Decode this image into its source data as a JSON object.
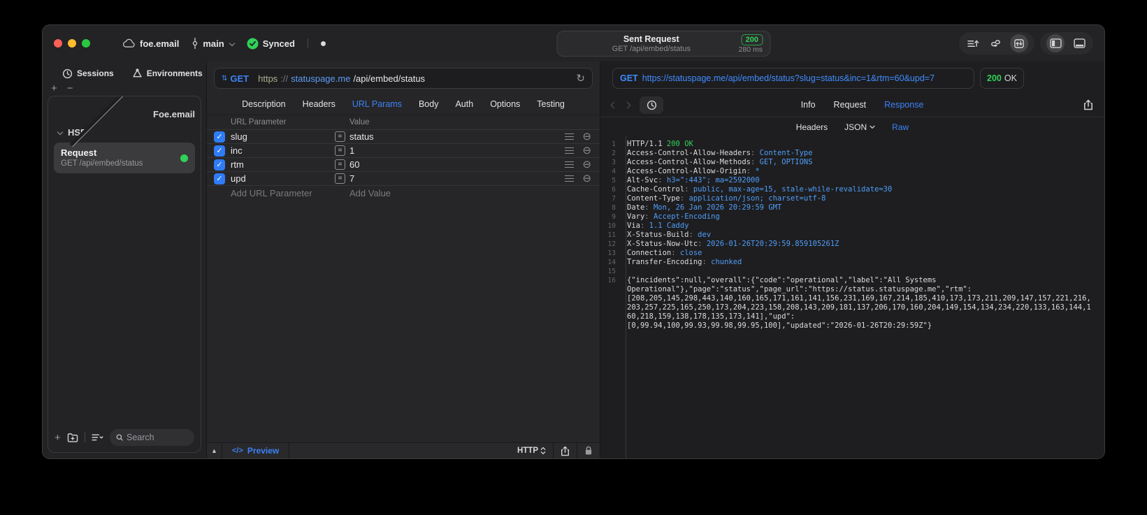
{
  "titlebar": {
    "project": "foe.email",
    "branch": "main",
    "sync_label": "Synced",
    "center": {
      "title": "Sent Request",
      "subtitle": "GET /api/embed/status",
      "status_code": "200",
      "duration": "280 ms"
    }
  },
  "sidebar": {
    "tabs": [
      {
        "label": "Sessions"
      },
      {
        "label": "Environments"
      }
    ],
    "tree": [
      {
        "label": "Foe.email",
        "state": "collapsed"
      },
      {
        "label": "HSP",
        "state": "expanded"
      }
    ],
    "request": {
      "title": "Request",
      "subtitle": "GET /api/embed/status"
    },
    "search_placeholder": "Search"
  },
  "request_panel": {
    "method": "GET",
    "url": {
      "scheme": "https",
      "separator": "://",
      "host": "statuspage.me",
      "path": "/api/embed/status"
    },
    "tabs": [
      "Description",
      "Headers",
      "URL Params",
      "Body",
      "Auth",
      "Options",
      "Testing"
    ],
    "active_tab": "URL Params",
    "params": {
      "col_param": "URL Parameter",
      "col_value": "Value",
      "rows": [
        {
          "name": "slug",
          "value": "status",
          "checked": true
        },
        {
          "name": "inc",
          "value": "1",
          "checked": true
        },
        {
          "name": "rtm",
          "value": "60",
          "checked": true
        },
        {
          "name": "upd",
          "value": "7",
          "checked": true
        }
      ],
      "add_param": "Add URL Parameter",
      "add_value": "Add Value"
    },
    "footer": {
      "preview": "Preview",
      "protocol": "HTTP"
    }
  },
  "response_panel": {
    "method": "GET",
    "url": "https://statuspage.me/api/embed/status?slug=status&inc=1&rtm=60&upd=7",
    "status_code": "200",
    "status_text": "OK",
    "tabs": [
      "Info",
      "Request",
      "Response"
    ],
    "active_tab": "Response",
    "subtabs": [
      "Headers",
      "JSON",
      "Raw"
    ],
    "active_subtab": "Raw",
    "code_lines": [
      {
        "num": "1",
        "seg": [
          [
            "w",
            "HTTP/1.1 "
          ],
          [
            "g",
            "200 OK"
          ]
        ]
      },
      {
        "num": "2",
        "seg": [
          [
            "w",
            "Access-Control-Allow-Headers"
          ],
          [
            "d",
            ": "
          ],
          [
            "b",
            "Content-Type"
          ]
        ]
      },
      {
        "num": "3",
        "seg": [
          [
            "w",
            "Access-Control-Allow-Methods"
          ],
          [
            "d",
            ": "
          ],
          [
            "b",
            "GET, OPTIONS"
          ]
        ]
      },
      {
        "num": "4",
        "seg": [
          [
            "w",
            "Access-Control-Allow-Origin"
          ],
          [
            "d",
            ": "
          ],
          [
            "b",
            "*"
          ]
        ]
      },
      {
        "num": "5",
        "seg": [
          [
            "w",
            "Alt-Svc"
          ],
          [
            "d",
            ": "
          ],
          [
            "b",
            "h3=\":443\"; ma=2592000"
          ]
        ]
      },
      {
        "num": "6",
        "seg": [
          [
            "w",
            "Cache-Control"
          ],
          [
            "d",
            ": "
          ],
          [
            "b",
            "public, max-age=15, stale-while-revalidate=30"
          ]
        ]
      },
      {
        "num": "7",
        "seg": [
          [
            "w",
            "Content-Type"
          ],
          [
            "d",
            ": "
          ],
          [
            "b",
            "application/json; charset=utf-8"
          ]
        ]
      },
      {
        "num": "8",
        "seg": [
          [
            "w",
            "Date"
          ],
          [
            "d",
            ": "
          ],
          [
            "b",
            "Mon, 26 Jan 2026 20:29:59 GMT"
          ]
        ]
      },
      {
        "num": "9",
        "seg": [
          [
            "w",
            "Vary"
          ],
          [
            "d",
            ": "
          ],
          [
            "b",
            "Accept-Encoding"
          ]
        ]
      },
      {
        "num": "10",
        "seg": [
          [
            "w",
            "Via"
          ],
          [
            "d",
            ": "
          ],
          [
            "b",
            "1.1 Caddy"
          ]
        ]
      },
      {
        "num": "11",
        "seg": [
          [
            "w",
            "X-Status-Build"
          ],
          [
            "d",
            ": "
          ],
          [
            "b",
            "dev"
          ]
        ]
      },
      {
        "num": "12",
        "seg": [
          [
            "w",
            "X-Status-Now-Utc"
          ],
          [
            "d",
            ": "
          ],
          [
            "b",
            "2026-01-26T20:29:59.859105261Z"
          ]
        ]
      },
      {
        "num": "13",
        "seg": [
          [
            "w",
            "Connection"
          ],
          [
            "d",
            ": "
          ],
          [
            "b",
            "close"
          ]
        ]
      },
      {
        "num": "14",
        "seg": [
          [
            "w",
            "Transfer-Encoding"
          ],
          [
            "d",
            ": "
          ],
          [
            "b",
            "chunked"
          ]
        ]
      },
      {
        "num": "15",
        "seg": []
      },
      {
        "num": "16",
        "seg": [
          [
            "w",
            "{\"incidents\":null,\"overall\":{\"code\":\"operational\",\"label\":\"All Systems"
          ]
        ]
      },
      {
        "num": "",
        "seg": [
          [
            "w",
            "Operational\"},\"page\":\"status\",\"page_url\":\"https://status.statuspage.me\",\"rtm\":"
          ]
        ]
      },
      {
        "num": "",
        "seg": [
          [
            "w",
            "[208,205,145,298,443,140,160,165,171,161,141,156,231,169,167,214,185,410,173,173,211,209,147,157,221,216,"
          ]
        ]
      },
      {
        "num": "",
        "seg": [
          [
            "w",
            "203,257,225,165,250,173,204,223,158,208,143,209,181,137,206,170,160,204,149,154,134,234,220,133,163,144,1"
          ]
        ]
      },
      {
        "num": "",
        "seg": [
          [
            "w",
            "60,218,159,138,178,135,173,141],\"upd\":"
          ]
        ]
      },
      {
        "num": "",
        "seg": [
          [
            "w",
            "[0,99.94,100,99.93,99.98,99.95,100],\"updated\":\"2026-01-26T20:29:59Z\"}"
          ]
        ]
      }
    ]
  },
  "icons": {
    "method_stepper": "⇅",
    "refresh": "↻",
    "minus_circle": "⊖",
    "check": "✓",
    "plus": "+",
    "minus": "−",
    "collapse": "▲",
    "code_tag": "</>"
  },
  "colors": {
    "accent_blue": "#3d82f7",
    "code_value_blue": "#4f9df8",
    "status_green": "#32d158",
    "traffic_red": "#ff5f57",
    "traffic_yellow": "#febc2e",
    "traffic_green": "#28c840",
    "checkbox_blue": "#2f7cf6"
  }
}
